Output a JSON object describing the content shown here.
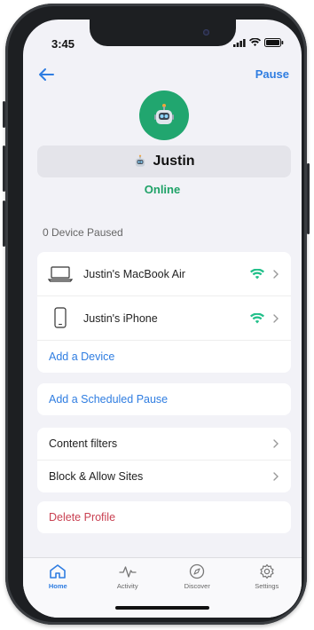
{
  "status_bar": {
    "time": "3:45"
  },
  "header": {
    "pause_label": "Pause"
  },
  "profile": {
    "name": "Justin",
    "status": "Online"
  },
  "devices": {
    "section_label": "0 Device Paused",
    "items": [
      {
        "name": "Justin's MacBook Air",
        "icon": "laptop-icon"
      },
      {
        "name": "Justin's iPhone",
        "icon": "phone-icon"
      }
    ],
    "add_label": "Add a Device"
  },
  "schedule": {
    "add_label": "Add a Scheduled Pause"
  },
  "settings": {
    "items": [
      {
        "label": "Content filters"
      },
      {
        "label": "Block & Allow Sites"
      }
    ]
  },
  "danger": {
    "delete_label": "Delete Profile"
  },
  "tabbar": {
    "tabs": [
      {
        "label": "Home",
        "icon": "home-icon",
        "active": true
      },
      {
        "label": "Activity",
        "icon": "activity-icon",
        "active": false
      },
      {
        "label": "Discover",
        "icon": "discover-icon",
        "active": false
      },
      {
        "label": "Settings",
        "icon": "gear-icon",
        "active": false
      }
    ]
  },
  "colors": {
    "accent": "#2f7de1",
    "online": "#1fa267",
    "avatar_bg": "#21a66f",
    "wifi": "#22c08a",
    "danger": "#c94152"
  }
}
